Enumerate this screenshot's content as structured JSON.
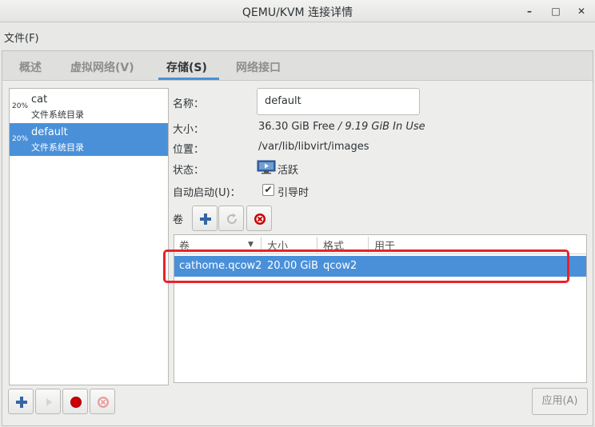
{
  "window": {
    "title": "QEMU/KVM 连接详情",
    "min_glyph": "–",
    "max_glyph": "□",
    "close_glyph": "✕"
  },
  "menu": {
    "file": "文件(F)"
  },
  "tabs": [
    {
      "label": "概述",
      "active": false
    },
    {
      "label": "虚拟网络(V)",
      "active": false
    },
    {
      "label": "存储(S)",
      "active": true
    },
    {
      "label": "网络接口",
      "active": false
    }
  ],
  "pools": [
    {
      "percent": "20%",
      "name": "cat",
      "type": "文件系统目录",
      "selected": false
    },
    {
      "percent": "20%",
      "name": "default",
      "type": "文件系统目录",
      "selected": true
    }
  ],
  "details": {
    "name_label": "名称：",
    "name_value": "default",
    "size_label": "大小：",
    "size_free": "36.30 GiB Free",
    "size_sep": " / ",
    "size_used": "9.19 GiB In Use",
    "location_label": "位置：",
    "location_value": "/var/lib/libvirt/images",
    "state_label": "状态：",
    "state_value": "活跃",
    "autostart_label": "自动启动(U)：",
    "autostart_value": "引导时",
    "autostart_checked": true,
    "volumes_label": "卷"
  },
  "volume_table": {
    "columns": [
      "卷",
      "大小",
      "格式",
      "用于"
    ],
    "rows": [
      {
        "name": "cathome.qcow2",
        "size": "20.00 GiB",
        "format": "qcow2",
        "used_by": "",
        "selected": true
      }
    ]
  },
  "buttons": {
    "apply": "应用(A)"
  },
  "colors": {
    "accent": "#4a90d9",
    "highlight": "#e8232a",
    "delete": "#cc0000"
  }
}
